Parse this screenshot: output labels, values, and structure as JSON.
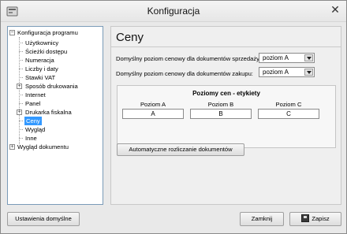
{
  "window": {
    "title": "Konfiguracja"
  },
  "tree": {
    "items": [
      {
        "label": "Konfiguracja programu"
      },
      {
        "label": "Użytkownicy"
      },
      {
        "label": "Ścieżki dostępu"
      },
      {
        "label": "Numeracja"
      },
      {
        "label": "Liczby i daty"
      },
      {
        "label": "Stawki VAT"
      },
      {
        "label": "Sposób drukowania"
      },
      {
        "label": "Internet"
      },
      {
        "label": "Panel"
      },
      {
        "label": "Drukarka fiskalna"
      },
      {
        "label": "Ceny"
      },
      {
        "label": "Wygląd"
      },
      {
        "label": "Inne"
      },
      {
        "label": "Wygląd dokumentu"
      }
    ]
  },
  "main": {
    "heading": "Ceny",
    "sales_label": "Domyślny poziom cenowy dla dokumentów sprzedaży:",
    "sales_value": "poziom A",
    "purchase_label": "Domyślny poziom cenowy dla dokumentów zakupu:",
    "purchase_value": "poziom A",
    "group_title": "Poziomy cen - etykiety",
    "levels": [
      {
        "label": "Poziom A",
        "value": "A"
      },
      {
        "label": "Poziom B",
        "value": "B"
      },
      {
        "label": "Poziom C",
        "value": "C"
      }
    ],
    "auto_button": "Automatyczne rozliczanie dokumentów"
  },
  "footer": {
    "defaults_button": "Ustawienia domyślne",
    "close_button": "Zamknij",
    "save_button": "Zapisz"
  },
  "colors": {
    "selection": "#3399ff",
    "tree_border": "#7a9bb8"
  }
}
